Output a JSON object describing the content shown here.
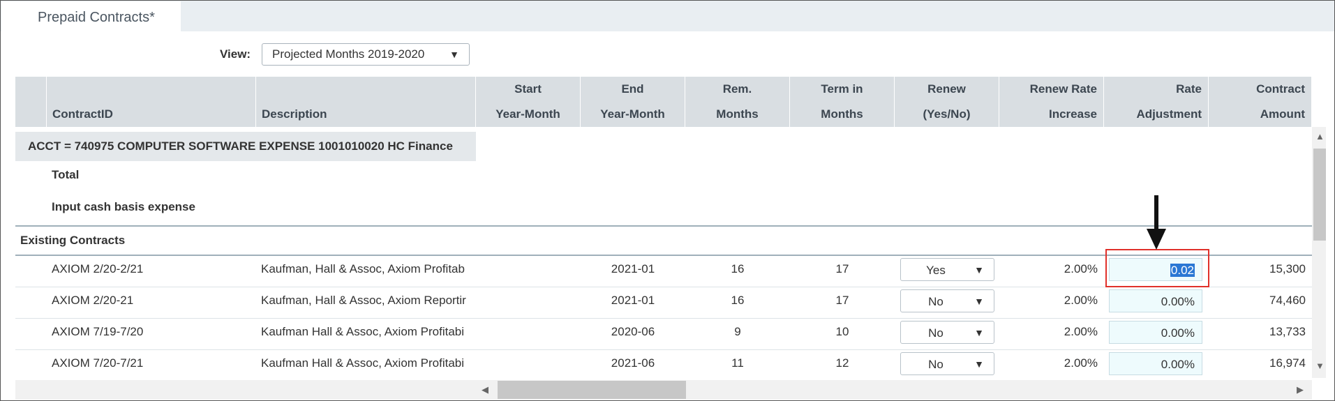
{
  "tab": {
    "label": "Prepaid Contracts*"
  },
  "view": {
    "label": "View:",
    "value": "Projected  Months 2019-2020"
  },
  "columns": [
    {
      "line1": "",
      "line2": "ContractID"
    },
    {
      "line1": "",
      "line2": "Description"
    },
    {
      "line1": "Start",
      "line2": "Year-Month"
    },
    {
      "line1": "End",
      "line2": "Year-Month"
    },
    {
      "line1": "Rem.",
      "line2": "Months"
    },
    {
      "line1": "Term in",
      "line2": "Months"
    },
    {
      "line1": "Renew",
      "line2": "(Yes/No)"
    },
    {
      "line1": "Renew Rate",
      "line2": "Increase"
    },
    {
      "line1": "Rate",
      "line2": "Adjustment"
    },
    {
      "line1": "Contract",
      "line2": "Amount"
    }
  ],
  "group": {
    "account": "ACCT = 740975 COMPUTER SOFTWARE EXPENSE 1001010020 HC Finance",
    "total_label": "Total",
    "cash_label": "Input cash basis expense"
  },
  "section": {
    "label": "Existing Contracts"
  },
  "rows": [
    {
      "id": "AXIOM 2/20-2/21",
      "desc": "Kaufman, Hall & Assoc, Axiom Profitab",
      "start": "",
      "end": "2021-01",
      "rem": "16",
      "term": "17",
      "renew": "Yes",
      "rate_inc": "2.00%",
      "rate_adj": "0.02",
      "amount": "15,300"
    },
    {
      "id": "AXIOM 2/20-21",
      "desc": "Kaufman, Hall & Assoc, Axiom Reportir",
      "start": "",
      "end": "2021-01",
      "rem": "16",
      "term": "17",
      "renew": "No",
      "rate_inc": "2.00%",
      "rate_adj": "0.00%",
      "amount": "74,460"
    },
    {
      "id": "AXIOM 7/19-7/20",
      "desc": "Kaufman Hall & Assoc, Axiom Profitabi",
      "start": "",
      "end": "2020-06",
      "rem": "9",
      "term": "10",
      "renew": "No",
      "rate_inc": "2.00%",
      "rate_adj": "0.00%",
      "amount": "13,733"
    },
    {
      "id": "AXIOM 7/20-7/21",
      "desc": "Kaufman Hall & Assoc, Axiom Profitabi",
      "start": "",
      "end": "2021-06",
      "rem": "11",
      "term": "12",
      "renew": "No",
      "rate_inc": "2.00%",
      "rate_adj": "0.00%",
      "amount": "16,974"
    }
  ],
  "colors": {
    "header_bg": "#d9dee2",
    "input_bg": "#eefbfd",
    "highlight": "#2a77d4",
    "annotation_red": "#e0302a"
  },
  "annotation": {
    "icon": "down-arrow-icon"
  }
}
